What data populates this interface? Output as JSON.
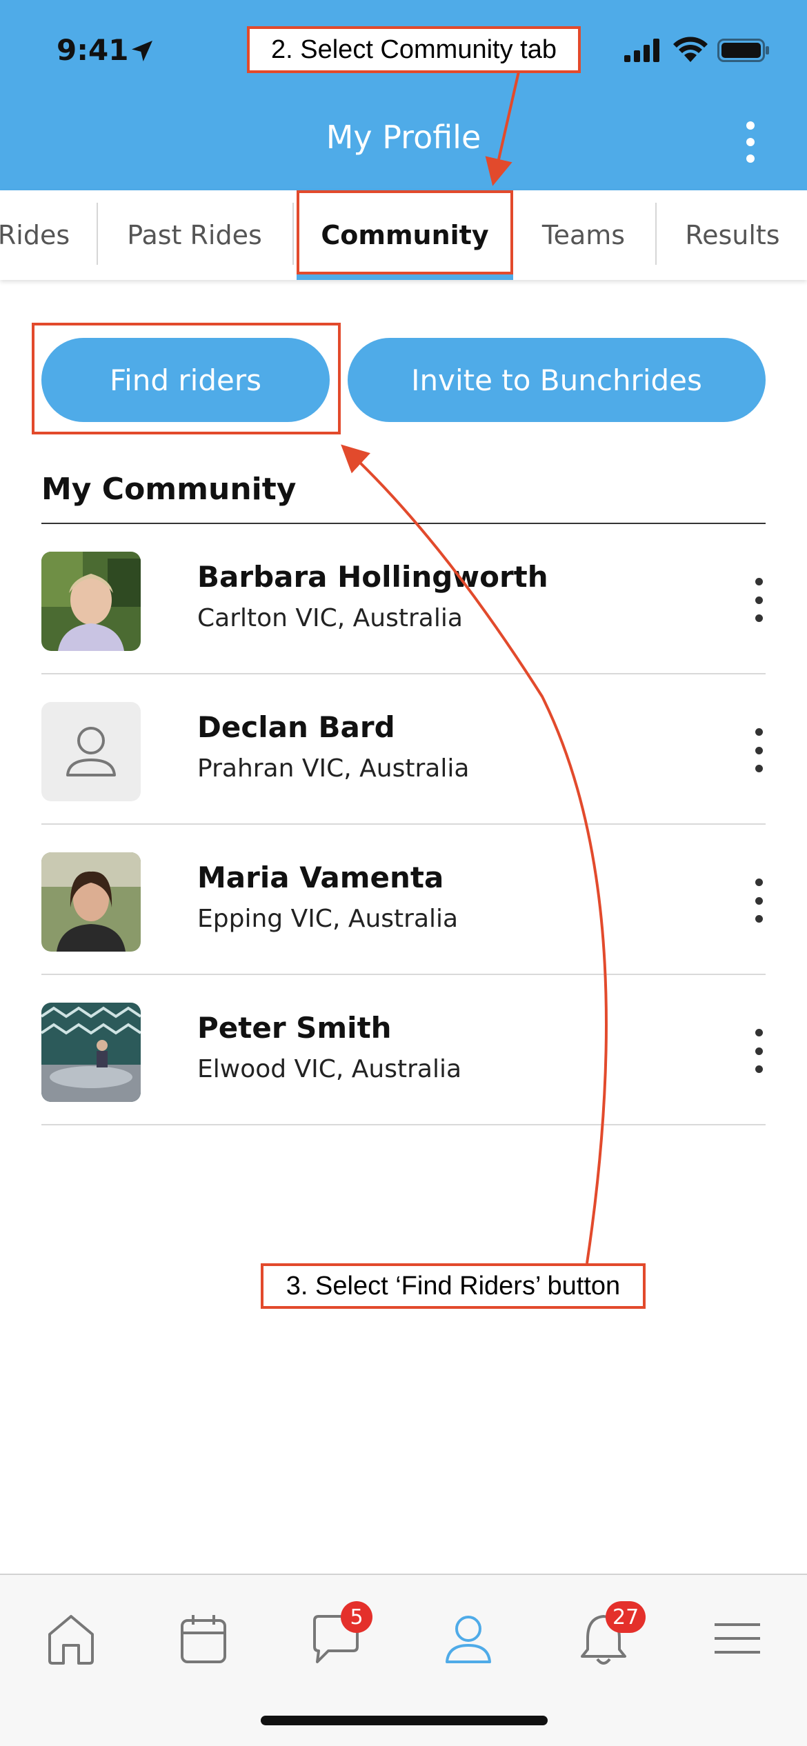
{
  "status_bar": {
    "time": "9:41"
  },
  "header": {
    "title": "My Profile"
  },
  "tabs": [
    {
      "label": "Rides"
    },
    {
      "label": "Past Rides"
    },
    {
      "label": "Community"
    },
    {
      "label": "Teams"
    },
    {
      "label": "Results"
    }
  ],
  "active_tab": "Community",
  "buttons": {
    "find": "Find riders",
    "invite": "Invite to Bunchrides"
  },
  "section": {
    "title": "My Community"
  },
  "members": [
    {
      "name": "Barbara Hollingworth",
      "location": "Carlton VIC, Australia"
    },
    {
      "name": "Declan Bard",
      "location": "Prahran VIC, Australia"
    },
    {
      "name": "Maria Vamenta",
      "location": "Epping VIC, Australia"
    },
    {
      "name": "Peter Smith",
      "location": "Elwood VIC, Australia"
    }
  ],
  "annotations": {
    "step2": "2. Select Community tab",
    "step3": "3. Select ‘Find Riders’ button"
  },
  "nav": {
    "messages_badge": "5",
    "notifications_badge": "27"
  },
  "colors": {
    "accent": "#4fabe8",
    "annotation": "#e24a2c",
    "badge": "#e4302b"
  }
}
